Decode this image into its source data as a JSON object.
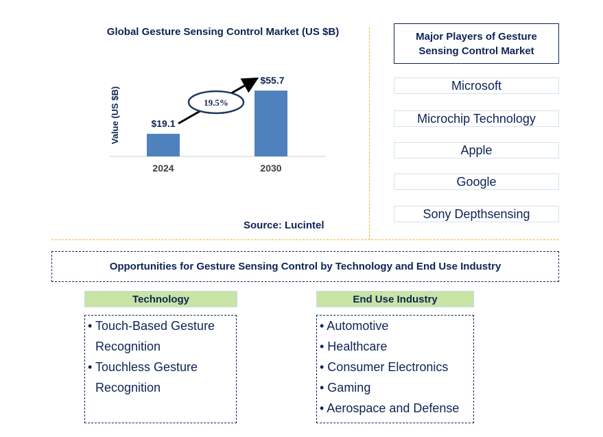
{
  "chart_data": {
    "type": "bar",
    "title": "Global Gesture Sensing Control Market (US $B)",
    "categories": [
      "2024",
      "2030"
    ],
    "values": [
      19.1,
      55.7
    ],
    "value_labels": [
      "$19.1",
      "$55.7"
    ],
    "xlabel": "",
    "ylabel": "Value (US $B)",
    "ylim": [
      0,
      65
    ],
    "grid": false,
    "annotation": {
      "type": "cagr-arrow",
      "label": "19.5%"
    },
    "bar_color": "#4f81bd",
    "source": "Source: Lucintel"
  },
  "players": {
    "title": "Major Players of Gesture Sensing Control Market",
    "items": [
      "Microsoft",
      "Microchip Technology",
      "Apple",
      "Google",
      "Sony Depthsensing"
    ]
  },
  "opportunities": {
    "title": "Opportunities for Gesture Sensing Control by Technology and End Use Industry",
    "technology": {
      "heading": "Technology",
      "items": [
        "• Touch-Based Gesture Recognition",
        "• Touchless Gesture Recognition"
      ]
    },
    "end_use": {
      "heading": "End Use Industry",
      "items": [
        "• Automotive",
        "• Healthcare",
        "• Consumer Electronics",
        "• Gaming",
        "• Aerospace and Defense"
      ]
    }
  },
  "colors": {
    "accent": "#0d2355",
    "bar": "#4f81bd",
    "divider": "#f0b429",
    "category_bg": "#c9e4a5"
  }
}
